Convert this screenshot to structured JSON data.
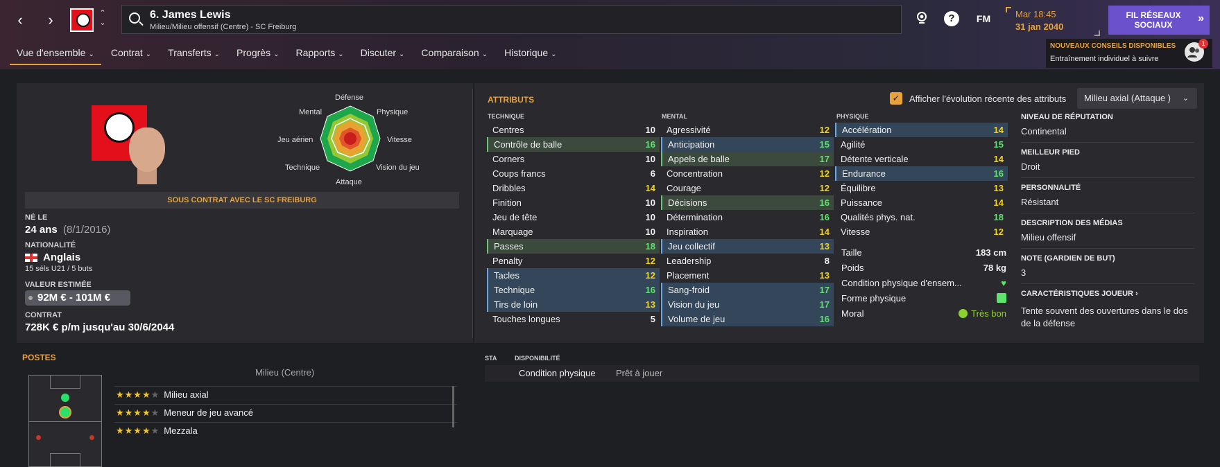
{
  "header": {
    "player_name": "6. James Lewis",
    "player_subtitle": "Milieu/Milieu offensif (Centre) - SC Freiburg",
    "fm_label": "FM",
    "help_label": "?",
    "date_time": "Mar 18:45",
    "date": "31 jan 2040",
    "social_button": "FIL RÉSEAUX SOCIAUX"
  },
  "tabs": [
    {
      "label": "Vue d'ensemble"
    },
    {
      "label": "Contrat"
    },
    {
      "label": "Transferts"
    },
    {
      "label": "Progrès"
    },
    {
      "label": "Rapports"
    },
    {
      "label": "Discuter"
    },
    {
      "label": "Comparaison"
    },
    {
      "label": "Historique"
    }
  ],
  "notification": {
    "title": "NOUVEAUX CONSEILS DISPONIBLES",
    "text": "Entraînement individuel à suivre",
    "count": "1"
  },
  "radar": {
    "defense": "Défense",
    "physique": "Physique",
    "vitesse": "Vitesse",
    "vision": "Vision du jeu",
    "attaque": "Attaque",
    "technique": "Technique",
    "jeu_aerien": "Jeu aérien",
    "mental": "Mental"
  },
  "profile": {
    "contract_banner": "SOUS CONTRAT AVEC LE SC FREIBURG",
    "born_label": "NÉ LE",
    "age": "24 ans",
    "birth_date": "(8/1/2016)",
    "nationality_label": "NATIONALITÉ",
    "nationality": "Anglais",
    "caps": "15 séls U21 / 5 buts",
    "value_label": "VALEUR ESTIMÉE",
    "value": "92M € - 101M €",
    "contract_label": "CONTRAT",
    "contract": "728K € p/m jusqu'au 30/6/2044"
  },
  "attributes": {
    "title": "ATTRIBUTS",
    "show_recent_label": "Afficher l'évolution récente des attributs",
    "role_dropdown": "Milieu axial (Attaque )",
    "technique_header": "TECHNIQUE",
    "mental_header": "MENTAL",
    "physique_header": "PHYSIQUE",
    "technique": [
      {
        "name": "Centres",
        "value": "10",
        "hl": ""
      },
      {
        "name": "Contrôle de balle",
        "value": "16",
        "hl": "g"
      },
      {
        "name": "Corners",
        "value": "10",
        "hl": ""
      },
      {
        "name": "Coups francs",
        "value": "6",
        "hl": ""
      },
      {
        "name": "Dribbles",
        "value": "14",
        "hl": ""
      },
      {
        "name": "Finition",
        "value": "10",
        "hl": ""
      },
      {
        "name": "Jeu de tête",
        "value": "10",
        "hl": ""
      },
      {
        "name": "Marquage",
        "value": "10",
        "hl": ""
      },
      {
        "name": "Passes",
        "value": "18",
        "hl": "g"
      },
      {
        "name": "Penalty",
        "value": "12",
        "hl": ""
      },
      {
        "name": "Tacles",
        "value": "12",
        "hl": "b"
      },
      {
        "name": "Technique",
        "value": "16",
        "hl": "b"
      },
      {
        "name": "Tirs de loin",
        "value": "13",
        "hl": "b"
      },
      {
        "name": "Touches longues",
        "value": "5",
        "hl": ""
      }
    ],
    "mental": [
      {
        "name": "Agressivité",
        "value": "12",
        "hl": ""
      },
      {
        "name": "Anticipation",
        "value": "15",
        "hl": "b"
      },
      {
        "name": "Appels de balle",
        "value": "17",
        "hl": "g"
      },
      {
        "name": "Concentration",
        "value": "12",
        "hl": ""
      },
      {
        "name": "Courage",
        "value": "12",
        "hl": ""
      },
      {
        "name": "Décisions",
        "value": "16",
        "hl": "g"
      },
      {
        "name": "Détermination",
        "value": "16",
        "hl": ""
      },
      {
        "name": "Inspiration",
        "value": "14",
        "hl": ""
      },
      {
        "name": "Jeu collectif",
        "value": "13",
        "hl": "b"
      },
      {
        "name": "Leadership",
        "value": "8",
        "hl": ""
      },
      {
        "name": "Placement",
        "value": "13",
        "hl": ""
      },
      {
        "name": "Sang-froid",
        "value": "17",
        "hl": "b"
      },
      {
        "name": "Vision du jeu",
        "value": "17",
        "hl": "b"
      },
      {
        "name": "Volume de jeu",
        "value": "16",
        "hl": "b"
      }
    ],
    "physique": [
      {
        "name": "Accélération",
        "value": "14",
        "hl": "b"
      },
      {
        "name": "Agilité",
        "value": "15",
        "hl": ""
      },
      {
        "name": "Détente verticale",
        "value": "14",
        "hl": ""
      },
      {
        "name": "Endurance",
        "value": "16",
        "hl": "b"
      },
      {
        "name": "Équilibre",
        "value": "13",
        "hl": ""
      },
      {
        "name": "Puissance",
        "value": "14",
        "hl": ""
      },
      {
        "name": "Qualités phys. nat.",
        "value": "18",
        "hl": ""
      },
      {
        "name": "Vitesse",
        "value": "12",
        "hl": ""
      }
    ],
    "height_label": "Taille",
    "height": "183 cm",
    "weight_label": "Poids",
    "weight": "78 kg",
    "condition_label": "Condition physique d'ensem...",
    "form_label": "Forme physique",
    "morale_label": "Moral",
    "morale": "Très bon"
  },
  "info": {
    "reputation_label": "NIVEAU DE RÉPUTATION",
    "reputation": "Continental",
    "foot_label": "MEILLEUR PIED",
    "foot": "Droit",
    "personality_label": "PERSONNALITÉ",
    "personality": "Résistant",
    "media_label": "DESCRIPTION DES MÉDIAS",
    "media": "Milieu offensif",
    "gk_label": "NOTE (GARDIEN DE BUT)",
    "gk": "3",
    "traits_label": "CARACTÉRISTIQUES JOUEUR",
    "traits": "Tente souvent des ouvertures dans le dos de la défense"
  },
  "positions": {
    "title": "POSTES",
    "main": "Milieu (Centre)",
    "roles": [
      {
        "name": "Milieu axial",
        "stars": 4
      },
      {
        "name": "Meneur de jeu avancé",
        "stars": 4
      },
      {
        "name": "Mezzala",
        "stars": 4
      }
    ]
  },
  "availability": {
    "sta_label": "STA",
    "disp_label": "DISPONIBILITÉ",
    "row_label": "Condition physique",
    "row_value": "Prêt à jouer"
  }
}
